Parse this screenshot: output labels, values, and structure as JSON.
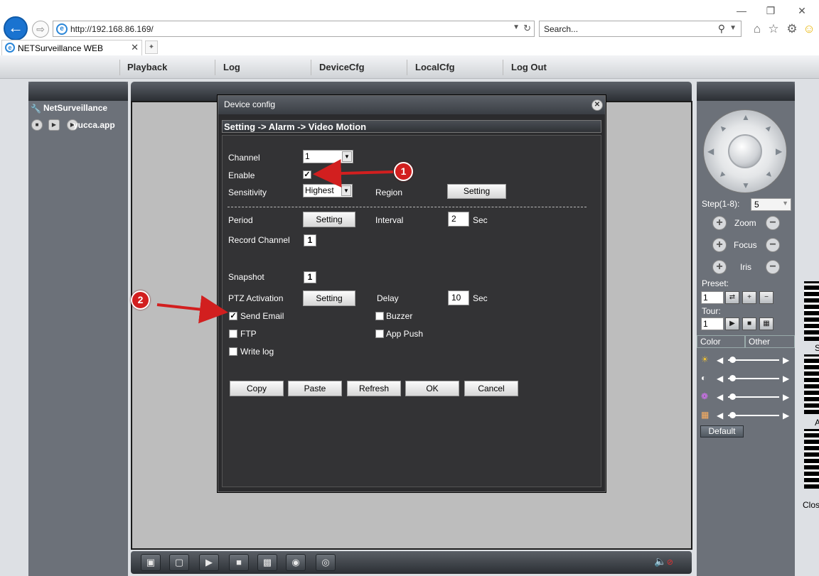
{
  "browser": {
    "url": "http://192.168.86.169/",
    "search_placeholder": "Search...",
    "tab_title": "NETSurveillance WEB"
  },
  "menu": {
    "items": [
      "Playback",
      "Log",
      "DeviceCfg",
      "LocalCfg",
      "Log Out"
    ]
  },
  "left_panel": {
    "title": "NetSurveillance",
    "device_name": "yucca.app"
  },
  "right_panel": {
    "step_label": "Step(1-8):",
    "step_value": "5",
    "zoom": "Zoom",
    "focus": "Focus",
    "iris": "Iris",
    "preset_label": "Preset:",
    "preset_value": "1",
    "tour_label": "Tour:",
    "tour_value": "1",
    "tab_color": "Color",
    "tab_other": "Other",
    "default_button": "Default"
  },
  "side_text": {
    "qr_label_1": "S",
    "qr_label_2": "A",
    "close": "Clos"
  },
  "dialog": {
    "title": "Device config",
    "breadcrumb": "Setting -> Alarm -> Video Motion",
    "channel_label": "Channel",
    "channel_value": "1",
    "enable_label": "Enable",
    "enable_checked": true,
    "sensitivity_label": "Sensitivity",
    "sensitivity_value": "Highest",
    "region_label": "Region",
    "setting_label": "Setting",
    "period_label": "Period",
    "interval_label": "Interval",
    "interval_value": "2",
    "sec_label": "Sec",
    "record_channel_label": "Record Channel",
    "record_channel_value": "1",
    "snapshot_label": "Snapshot",
    "snapshot_value": "1",
    "ptz_label": "PTZ Activation",
    "delay_label": "Delay",
    "delay_value": "10",
    "send_email_label": "Send Email",
    "send_email_checked": true,
    "buzzer_label": "Buzzer",
    "ftp_label": "FTP",
    "app_push_label": "App Push",
    "write_log_label": "Write log",
    "buttons": [
      "Copy",
      "Paste",
      "Refresh",
      "OK",
      "Cancel"
    ]
  },
  "annotations": {
    "callout_1": "1",
    "callout_2": "2",
    "color": "#d21f1f"
  }
}
